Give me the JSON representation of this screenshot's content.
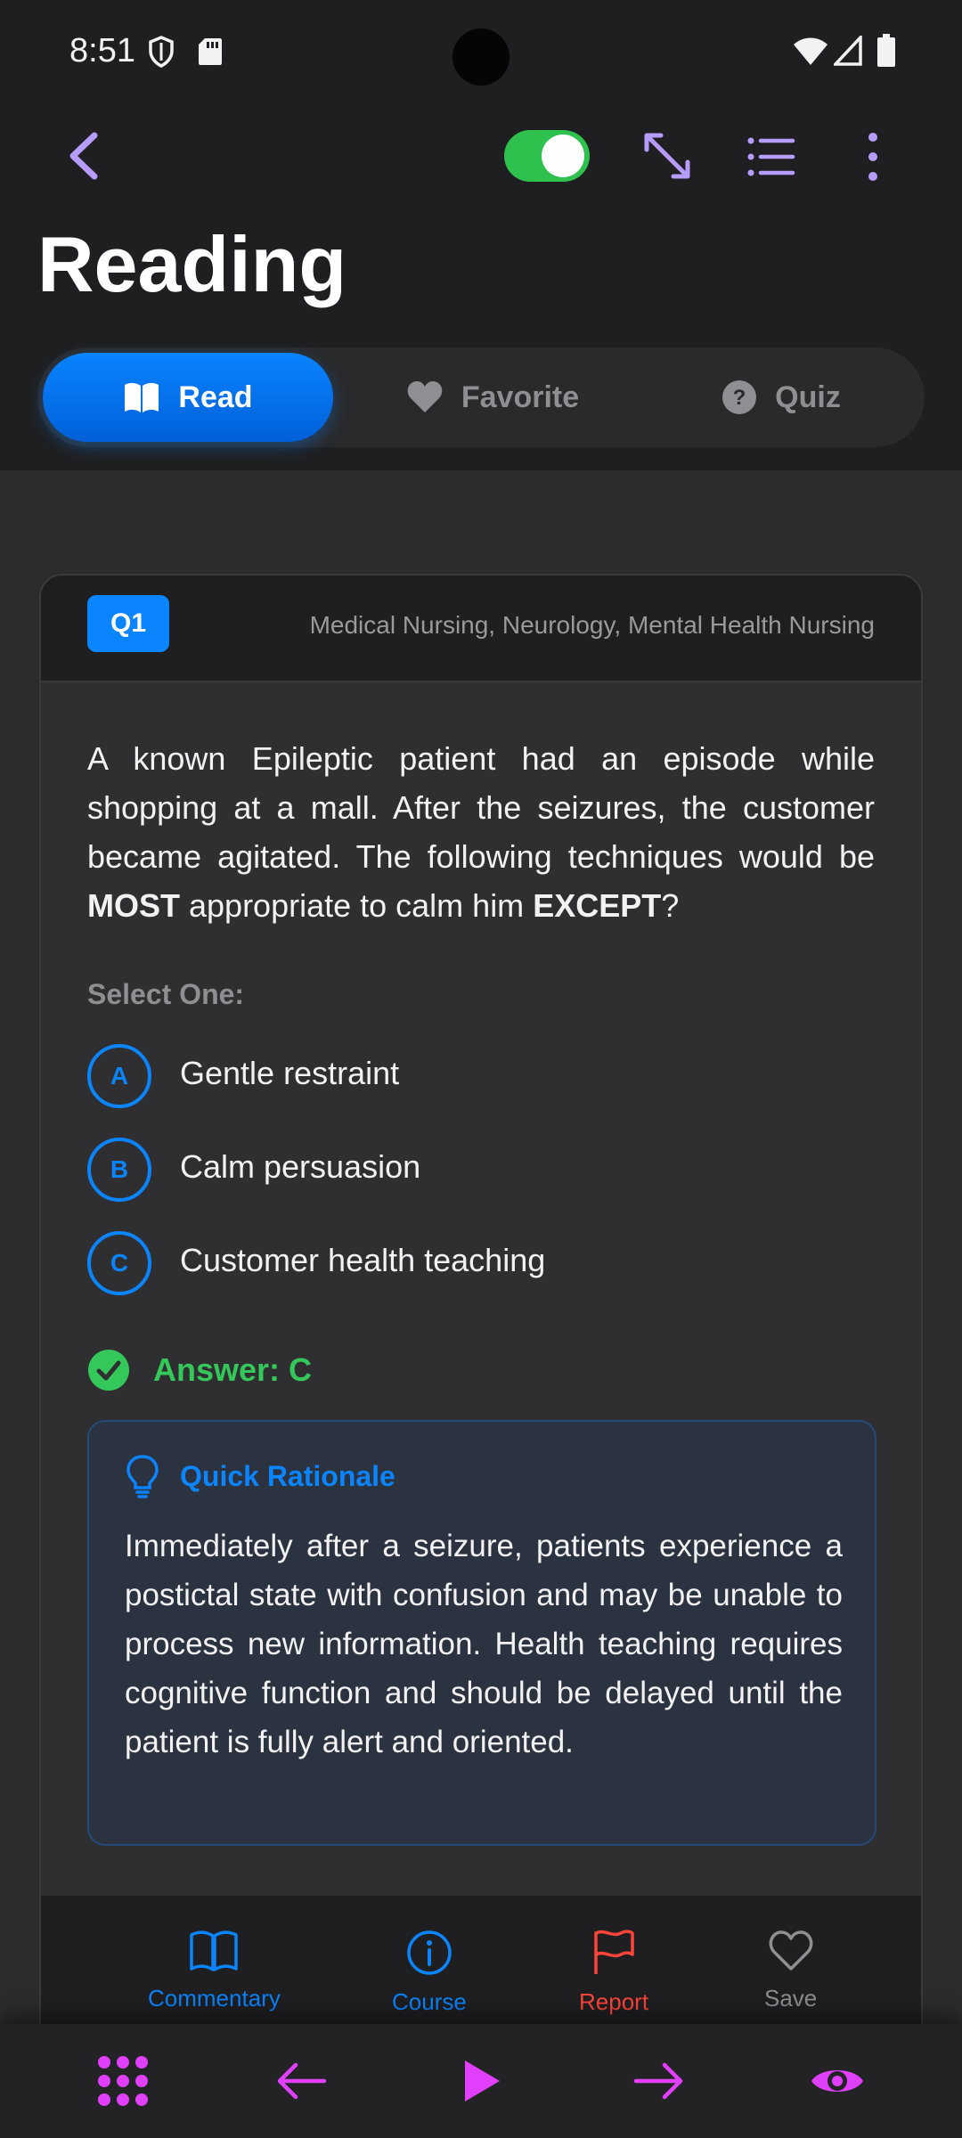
{
  "status_bar": {
    "time": "8:51",
    "left_icons": [
      "shield-icon",
      "sd-card-icon"
    ],
    "right_icons": [
      "wifi-icon",
      "signal-icon",
      "battery-icon"
    ]
  },
  "toolbar": {
    "back_icon": "chevron-left-icon",
    "toggle_on": true,
    "icons": [
      "expand-icon",
      "list-icon",
      "more-vertical-icon"
    ]
  },
  "page": {
    "title": "Reading"
  },
  "tabs": [
    {
      "label": "Read",
      "icon": "book-open-icon",
      "active": true
    },
    {
      "label": "Favorite",
      "icon": "heart-icon",
      "active": false
    },
    {
      "label": "Quiz",
      "icon": "help-circle-icon",
      "active": false
    }
  ],
  "card": {
    "badge": "Q1",
    "categories": "Medical Nursing, Neurology, Mental Health Nursing",
    "question": {
      "part1": "A known Epileptic patient had an episode while shopping at a mall. After the seizures, the customer became agitated. The following techniques would be ",
      "emph1": "MOST",
      "part2": " appropriate to calm him ",
      "emph2": "EXCEPT",
      "part3": "?"
    },
    "select_label": "Select One:",
    "options": [
      {
        "letter": "A",
        "text": "Gentle restraint"
      },
      {
        "letter": "B",
        "text": "Calm persuasion"
      },
      {
        "letter": "C",
        "text": "Customer health teaching"
      }
    ],
    "answer": "Answer: C",
    "rationale": {
      "title": "Quick Rationale",
      "body": "Immediately after a seizure, patients experience a postictal state with confusion and may be unable to process new information. Health teaching requires cognitive function and should be delayed until the patient is fully alert and oriented."
    },
    "actions": [
      {
        "label": "Commentary",
        "icon": "book-icon",
        "color": "#0a84ff"
      },
      {
        "label": "Course",
        "icon": "info-icon",
        "color": "#0a84ff"
      },
      {
        "label": "Report",
        "icon": "flag-icon",
        "color": "#ff453a"
      },
      {
        "label": "Save",
        "icon": "heart-outline-icon",
        "color": "#8e8e93"
      }
    ]
  },
  "bottom_nav": {
    "icons": [
      "grid-icon",
      "arrow-left-icon",
      "play-icon",
      "arrow-right-icon",
      "eye-icon"
    ],
    "color": "#e040fb"
  },
  "colors": {
    "accent": "#0a84ff",
    "success": "#34c759",
    "toggle": "#2fc14d",
    "danger": "#ff453a"
  }
}
